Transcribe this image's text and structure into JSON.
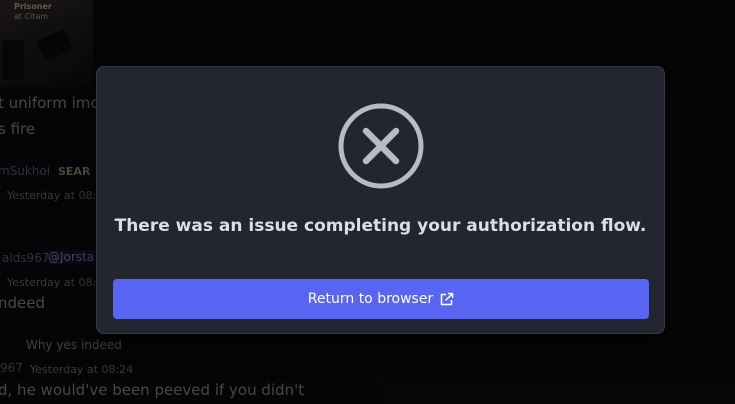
{
  "background": {
    "image_caption": [
      "Prisoner",
      "at Citam"
    ],
    "lines": [
      {
        "text": "t uniform imo"
      },
      {
        "text": "s fire"
      },
      {
        "text": "mSukhoi"
      },
      {
        "text": "SEAR"
      },
      {
        "text": "Yesterday at 08:0"
      },
      {
        "text": "alds967"
      },
      {
        "text": "@Jorsta"
      },
      {
        "text": "Yesterday at 08:0"
      },
      {
        "text": "ndeed"
      },
      {
        "text": "Why yes indeed"
      },
      {
        "text": "967"
      },
      {
        "text": "Yesterday at 08:24"
      },
      {
        "text": "d, he would've been peeved if you didn't"
      }
    ]
  },
  "modal": {
    "icon": "circle-x-icon",
    "message": "There was an issue completing your authorization flow.",
    "button_label": "Return to browser",
    "button_icon": "external-link-icon"
  },
  "colors": {
    "accent": "#5865f2",
    "modal_bg": "#232631",
    "icon": "#b9bbbe"
  }
}
